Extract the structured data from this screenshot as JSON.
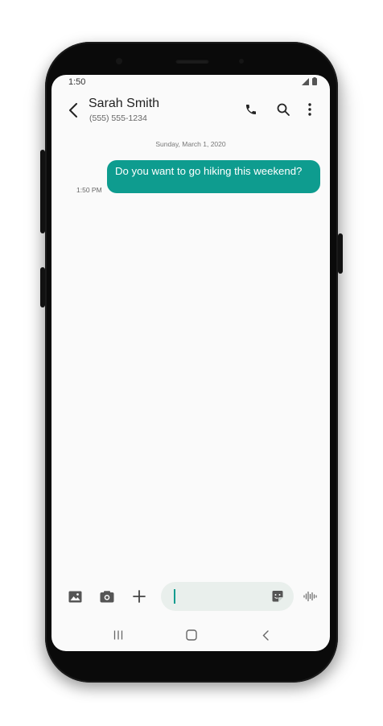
{
  "status_bar": {
    "time": "1:50",
    "signal_icon": "signal-icon",
    "battery_icon": "battery-icon"
  },
  "header": {
    "back_icon": "back-arrow-icon",
    "contact_name": "Sarah Smith",
    "contact_phone": "(555) 555-1234",
    "actions": [
      "phone-icon",
      "search-icon",
      "more-vert-icon"
    ]
  },
  "conversation": {
    "date_separator": "Sunday, March 1, 2020",
    "messages": [
      {
        "direction": "outgoing",
        "text": "Do you want to go hiking this weekend?",
        "time": "1:50 PM"
      }
    ]
  },
  "composer": {
    "buttons": [
      "gallery-icon",
      "camera-icon",
      "add-icon"
    ],
    "input_value": "",
    "sticker_icon": "sticker-icon",
    "voice_icon": "voice-recorder-icon"
  },
  "navigation_bar": [
    "recents-icon",
    "home-icon",
    "back-nav-icon"
  ],
  "colors": {
    "accent": "#0e9c8f",
    "background": "#fafafa",
    "input_bg": "#e9efec"
  }
}
